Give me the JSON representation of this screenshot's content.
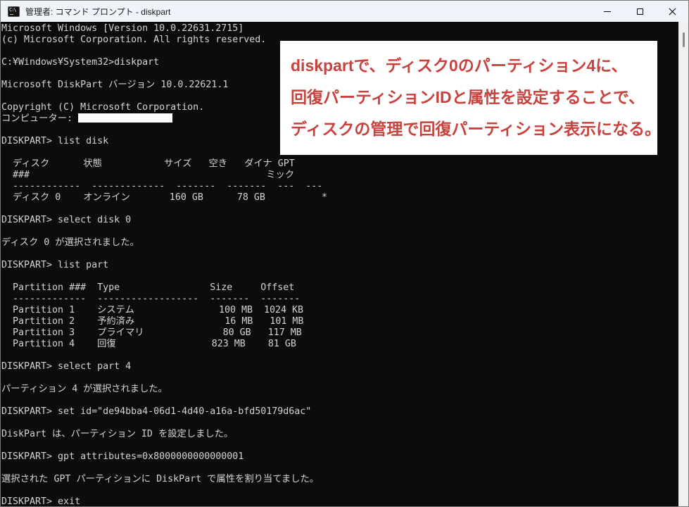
{
  "window": {
    "title": "管理者: コマンド プロンプト - diskpart",
    "icon": "command-prompt-icon",
    "icon_glyph": "C:\\",
    "controls": [
      "minimize",
      "maximize",
      "close"
    ]
  },
  "annotation": {
    "bg_color": "#ffffff",
    "text_color": "#c8423e",
    "lines": [
      "diskpartで、ディスク0のパーティション4に、",
      "回復パーティションIDと属性を設定することで、",
      "ディスクの管理で回復パーティション表示になる。"
    ]
  },
  "console": {
    "bg_color": "#0c0c0c",
    "text_color": "#d4d4d4",
    "lines": [
      "Microsoft Windows [Version 10.0.22631.2715]",
      "(c) Microsoft Corporation. All rights reserved.",
      "",
      "C:¥Windows¥System32>diskpart",
      "",
      "Microsoft DiskPart バージョン 10.0.22621.1",
      "",
      "Copyright (C) Microsoft Corporation.",
      {
        "text": "コンピューター: ",
        "redacted": true
      },
      "",
      "DISKPART> list disk",
      "",
      "  ディスク      状態           サイズ   空き   ダイナ GPT",
      "  ###                                          ミック",
      "  ------------  -------------  -------  -------  ---  ---",
      "  ディスク 0    オンライン       160 GB      78 GB          *",
      "",
      "DISKPART> select disk 0",
      "",
      "ディスク 0 が選択されました。",
      "",
      "DISKPART> list part",
      "",
      "  Partition ###  Type                Size     Offset",
      "  -------------  ------------------  -------  -------",
      "  Partition 1    システム               100 MB  1024 KB",
      "  Partition 2    予約済み                16 MB   101 MB",
      "  Partition 3    プライマリ              80 GB   117 MB",
      "  Partition 4    回復                 823 MB    81 GB",
      "",
      "DISKPART> select part 4",
      "",
      "パーティション 4 が選択されました。",
      "",
      "DISKPART> set id=\"de94bba4-06d1-4d40-a16a-bfd50179d6ac\"",
      "",
      "DiskPart は、パーティション ID を設定しました。",
      "",
      "DISKPART> gpt attributes=0x8000000000000001",
      "",
      "選択された GPT パーティションに DiskPart で属性を割り当てました。",
      "",
      "DISKPART> exit"
    ]
  },
  "scrollbar": {
    "track_color": "#f0f0f0",
    "thumb_color": "#8a8a8a"
  }
}
